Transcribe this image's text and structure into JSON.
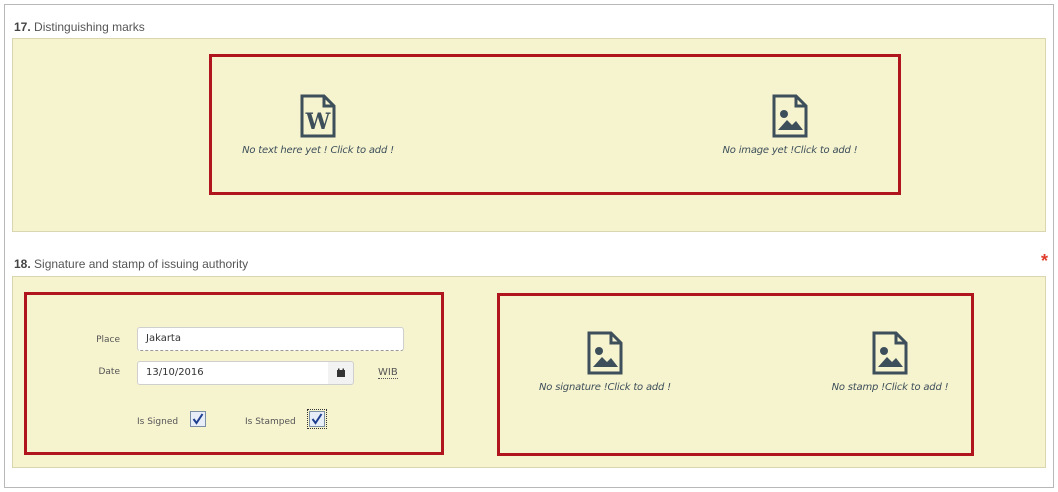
{
  "section17": {
    "number": "17.",
    "title": "Distinguishing marks",
    "text_slot": {
      "caption": "No text here yet ! Click to add !",
      "icon": "word-document-icon"
    },
    "image_slot": {
      "caption": "No image yet !Click to add !",
      "icon": "image-file-icon"
    }
  },
  "section18": {
    "number": "18.",
    "title": "Signature and stamp of issuing authority",
    "required_mark": "*",
    "place": {
      "label": "Place",
      "value": "Jakarta"
    },
    "date": {
      "label": "Date",
      "value": "13/10/2016",
      "timezone": "WIB"
    },
    "is_signed": {
      "label": "Is Signed",
      "checked": true
    },
    "is_stamped": {
      "label": "Is Stamped",
      "checked": true
    },
    "signature_slot": {
      "caption": "No signature !Click to add !",
      "icon": "image-file-icon"
    },
    "stamp_slot": {
      "caption": "No stamp !Click to add !",
      "icon": "image-file-icon"
    }
  },
  "colors": {
    "panel_bg": "#f6f3cf",
    "highlight": "#b0141c",
    "icon": "#3d4f5a",
    "required": "#e03a2a"
  }
}
